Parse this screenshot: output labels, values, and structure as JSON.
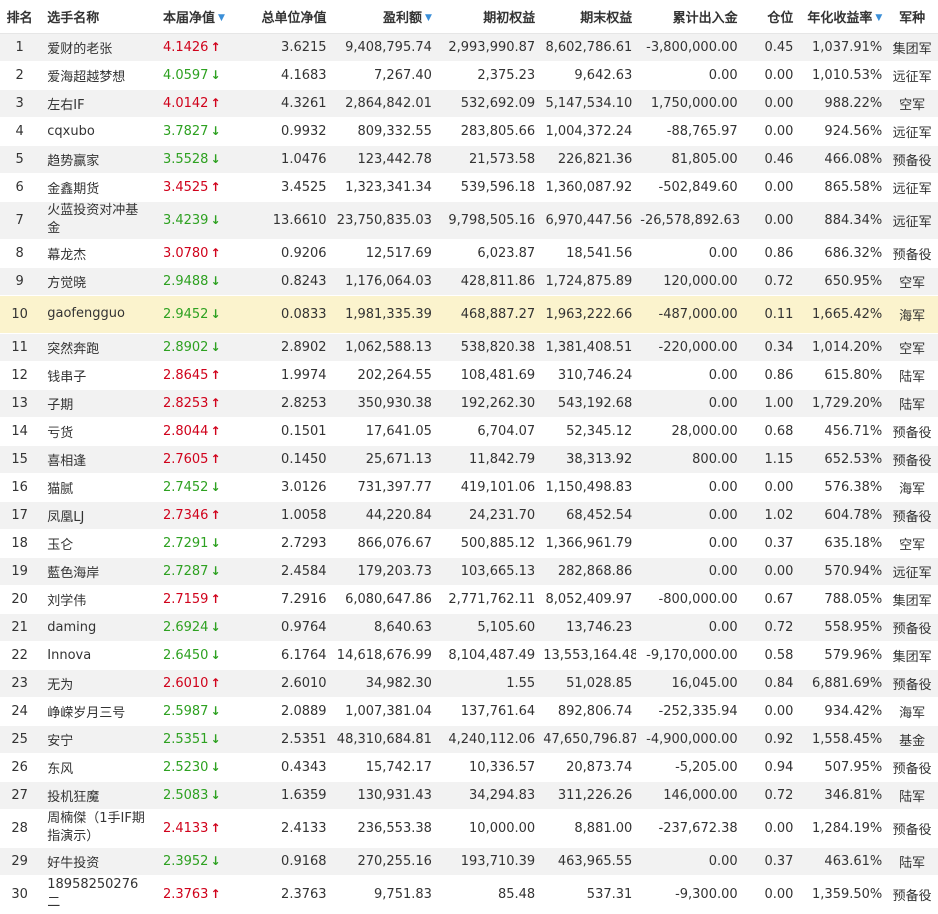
{
  "header": {
    "rank": "排名",
    "name": "选手名称",
    "nav": "本届净值",
    "unit_nav": "总单位净值",
    "profit": "盈利额",
    "init_equity": "期初权益",
    "end_equity": "期末权益",
    "net_flow": "累计出入金",
    "position": "仓位",
    "annual_return": "年化收益率",
    "army": "军种",
    "sort_indicator": "▼"
  },
  "colors": {
    "up": "#d0021b",
    "down": "#2ea121",
    "highlight": "#fbf3cd",
    "sort_icon": "#3b8fd8"
  },
  "icons": {
    "up": "arrow-up-icon",
    "down": "arrow-down-icon",
    "sort": "sort-down-icon"
  },
  "rows": [
    {
      "rank": "1",
      "name": "爱财的老张",
      "nav": "4.1426",
      "dir": "up",
      "unit_nav": "3.6215",
      "profit": "9,408,795.74",
      "init_equity": "2,993,990.87",
      "end_equity": "8,602,786.61",
      "net_flow": "-3,800,000.00",
      "position": "0.45",
      "annual_return": "1,037.91%",
      "army": "集团军"
    },
    {
      "rank": "2",
      "name": "爱海超越梦想",
      "nav": "4.0597",
      "dir": "down",
      "unit_nav": "4.1683",
      "profit": "7,267.40",
      "init_equity": "2,375.23",
      "end_equity": "9,642.63",
      "net_flow": "0.00",
      "position": "0.00",
      "annual_return": "1,010.53%",
      "army": "远征军"
    },
    {
      "rank": "3",
      "name": "左右IF",
      "nav": "4.0142",
      "dir": "up",
      "unit_nav": "4.3261",
      "profit": "2,864,842.01",
      "init_equity": "532,692.09",
      "end_equity": "5,147,534.10",
      "net_flow": "1,750,000.00",
      "position": "0.00",
      "annual_return": "988.22%",
      "army": "空军"
    },
    {
      "rank": "4",
      "name": "cqxubo",
      "nav": "3.7827",
      "dir": "down",
      "unit_nav": "0.9932",
      "profit": "809,332.55",
      "init_equity": "283,805.66",
      "end_equity": "1,004,372.24",
      "net_flow": "-88,765.97",
      "position": "0.00",
      "annual_return": "924.56%",
      "army": "远征军"
    },
    {
      "rank": "5",
      "name": "趋势赢家",
      "nav": "3.5528",
      "dir": "down",
      "unit_nav": "1.0476",
      "profit": "123,442.78",
      "init_equity": "21,573.58",
      "end_equity": "226,821.36",
      "net_flow": "81,805.00",
      "position": "0.46",
      "annual_return": "466.08%",
      "army": "预备役"
    },
    {
      "rank": "6",
      "name": "金鑫期货",
      "nav": "3.4525",
      "dir": "up",
      "unit_nav": "3.4525",
      "profit": "1,323,341.34",
      "init_equity": "539,596.18",
      "end_equity": "1,360,087.92",
      "net_flow": "-502,849.60",
      "position": "0.00",
      "annual_return": "865.58%",
      "army": "远征军"
    },
    {
      "rank": "7",
      "name": "火蓝投资对冲基金",
      "nav": "3.4239",
      "dir": "down",
      "unit_nav": "13.6610",
      "profit": "23,750,835.03",
      "init_equity": "9,798,505.16",
      "end_equity": "6,970,447.56",
      "net_flow": "-26,578,892.63",
      "position": "0.00",
      "annual_return": "884.34%",
      "army": "远征军"
    },
    {
      "rank": "8",
      "name": "幕龙杰",
      "nav": "3.0780",
      "dir": "up",
      "unit_nav": "0.9206",
      "profit": "12,517.69",
      "init_equity": "6,023.87",
      "end_equity": "18,541.56",
      "net_flow": "0.00",
      "position": "0.86",
      "annual_return": "686.32%",
      "army": "预备役"
    },
    {
      "rank": "9",
      "name": "方觉晓",
      "nav": "2.9488",
      "dir": "down",
      "unit_nav": "0.8243",
      "profit": "1,176,064.03",
      "init_equity": "428,811.86",
      "end_equity": "1,724,875.89",
      "net_flow": "120,000.00",
      "position": "0.72",
      "annual_return": "650.95%",
      "army": "空军"
    },
    {
      "rank": "10",
      "name": "gaofengguo",
      "nav": "2.9452",
      "dir": "down",
      "unit_nav": "0.0833",
      "profit": "1,981,335.39",
      "init_equity": "468,887.27",
      "end_equity": "1,963,222.66",
      "net_flow": "-487,000.00",
      "position": "0.11",
      "annual_return": "1,665.42%",
      "army": "海军",
      "highlight": true
    },
    {
      "rank": "11",
      "name": "突然奔跑",
      "nav": "2.8902",
      "dir": "down",
      "unit_nav": "2.8902",
      "profit": "1,062,588.13",
      "init_equity": "538,820.38",
      "end_equity": "1,381,408.51",
      "net_flow": "-220,000.00",
      "position": "0.34",
      "annual_return": "1,014.20%",
      "army": "空军"
    },
    {
      "rank": "12",
      "name": "钱串子",
      "nav": "2.8645",
      "dir": "up",
      "unit_nav": "1.9974",
      "profit": "202,264.55",
      "init_equity": "108,481.69",
      "end_equity": "310,746.24",
      "net_flow": "0.00",
      "position": "0.86",
      "annual_return": "615.80%",
      "army": "陆军"
    },
    {
      "rank": "13",
      "name": "子期",
      "nav": "2.8253",
      "dir": "up",
      "unit_nav": "2.8253",
      "profit": "350,930.38",
      "init_equity": "192,262.30",
      "end_equity": "543,192.68",
      "net_flow": "0.00",
      "position": "1.00",
      "annual_return": "1,729.20%",
      "army": "陆军"
    },
    {
      "rank": "14",
      "name": "亏货",
      "nav": "2.8044",
      "dir": "up",
      "unit_nav": "0.1501",
      "profit": "17,641.05",
      "init_equity": "6,704.07",
      "end_equity": "52,345.12",
      "net_flow": "28,000.00",
      "position": "0.68",
      "annual_return": "456.71%",
      "army": "预备役"
    },
    {
      "rank": "15",
      "name": "喜相逢",
      "nav": "2.7605",
      "dir": "up",
      "unit_nav": "0.1450",
      "profit": "25,671.13",
      "init_equity": "11,842.79",
      "end_equity": "38,313.92",
      "net_flow": "800.00",
      "position": "1.15",
      "annual_return": "652.53%",
      "army": "预备役"
    },
    {
      "rank": "16",
      "name": "猫腻",
      "nav": "2.7452",
      "dir": "down",
      "unit_nav": "3.0126",
      "profit": "731,397.77",
      "init_equity": "419,101.06",
      "end_equity": "1,150,498.83",
      "net_flow": "0.00",
      "position": "0.00",
      "annual_return": "576.38%",
      "army": "海军"
    },
    {
      "rank": "17",
      "name": "凤凰LJ",
      "nav": "2.7346",
      "dir": "up",
      "unit_nav": "1.0058",
      "profit": "44,220.84",
      "init_equity": "24,231.70",
      "end_equity": "68,452.54",
      "net_flow": "0.00",
      "position": "1.02",
      "annual_return": "604.78%",
      "army": "预备役"
    },
    {
      "rank": "18",
      "name": "玉仑",
      "nav": "2.7291",
      "dir": "down",
      "unit_nav": "2.7293",
      "profit": "866,076.67",
      "init_equity": "500,885.12",
      "end_equity": "1,366,961.79",
      "net_flow": "0.00",
      "position": "0.37",
      "annual_return": "635.18%",
      "army": "空军"
    },
    {
      "rank": "19",
      "name": "藍色海岸",
      "nav": "2.7287",
      "dir": "down",
      "unit_nav": "2.4584",
      "profit": "179,203.73",
      "init_equity": "103,665.13",
      "end_equity": "282,868.86",
      "net_flow": "0.00",
      "position": "0.00",
      "annual_return": "570.94%",
      "army": "远征军"
    },
    {
      "rank": "20",
      "name": "刘学伟",
      "nav": "2.7159",
      "dir": "up",
      "unit_nav": "7.2916",
      "profit": "6,080,647.86",
      "init_equity": "2,771,762.11",
      "end_equity": "8,052,409.97",
      "net_flow": "-800,000.00",
      "position": "0.67",
      "annual_return": "788.05%",
      "army": "集团军"
    },
    {
      "rank": "21",
      "name": "daming",
      "nav": "2.6924",
      "dir": "down",
      "unit_nav": "0.9764",
      "profit": "8,640.63",
      "init_equity": "5,105.60",
      "end_equity": "13,746.23",
      "net_flow": "0.00",
      "position": "0.72",
      "annual_return": "558.95%",
      "army": "预备役"
    },
    {
      "rank": "22",
      "name": "Innova",
      "nav": "2.6450",
      "dir": "down",
      "unit_nav": "6.1764",
      "profit": "14,618,676.99",
      "init_equity": "8,104,487.49",
      "end_equity": "13,553,164.48",
      "net_flow": "-9,170,000.00",
      "position": "0.58",
      "annual_return": "579.96%",
      "army": "集团军"
    },
    {
      "rank": "23",
      "name": "无为",
      "nav": "2.6010",
      "dir": "up",
      "unit_nav": "2.6010",
      "profit": "34,982.30",
      "init_equity": "1.55",
      "end_equity": "51,028.85",
      "net_flow": "16,045.00",
      "position": "0.84",
      "annual_return": "6,881.69%",
      "army": "预备役"
    },
    {
      "rank": "24",
      "name": "峥嵘岁月三号",
      "nav": "2.5987",
      "dir": "down",
      "unit_nav": "2.0889",
      "profit": "1,007,381.04",
      "init_equity": "137,761.64",
      "end_equity": "892,806.74",
      "net_flow": "-252,335.94",
      "position": "0.00",
      "annual_return": "934.42%",
      "army": "海军"
    },
    {
      "rank": "25",
      "name": "安宁",
      "nav": "2.5351",
      "dir": "down",
      "unit_nav": "2.5351",
      "profit": "48,310,684.81",
      "init_equity": "4,240,112.06",
      "end_equity": "47,650,796.87",
      "net_flow": "-4,900,000.00",
      "position": "0.92",
      "annual_return": "1,558.45%",
      "army": "基金"
    },
    {
      "rank": "26",
      "name": "东风",
      "nav": "2.5230",
      "dir": "down",
      "unit_nav": "0.4343",
      "profit": "15,742.17",
      "init_equity": "10,336.57",
      "end_equity": "20,873.74",
      "net_flow": "-5,205.00",
      "position": "0.94",
      "annual_return": "507.95%",
      "army": "预备役"
    },
    {
      "rank": "27",
      "name": "投机狂魔",
      "nav": "2.5083",
      "dir": "down",
      "unit_nav": "1.6359",
      "profit": "130,931.43",
      "init_equity": "34,294.83",
      "end_equity": "311,226.26",
      "net_flow": "146,000.00",
      "position": "0.72",
      "annual_return": "346.81%",
      "army": "陆军"
    },
    {
      "rank": "28",
      "name": "周楠傑（1手IF期指演示）",
      "nav": "2.4133",
      "dir": "up",
      "unit_nav": "2.4133",
      "profit": "236,553.38",
      "init_equity": "10,000.00",
      "end_equity": "8,881.00",
      "net_flow": "-237,672.38",
      "position": "0.00",
      "annual_return": "1,284.19%",
      "army": "预备役"
    },
    {
      "rank": "29",
      "name": "好牛投资",
      "nav": "2.3952",
      "dir": "down",
      "unit_nav": "0.9168",
      "profit": "270,255.16",
      "init_equity": "193,710.39",
      "end_equity": "463,965.55",
      "net_flow": "0.00",
      "position": "0.37",
      "annual_return": "463.61%",
      "army": "陆军"
    },
    {
      "rank": "30",
      "name": "18958250276二",
      "nav": "2.3763",
      "dir": "up",
      "unit_nav": "2.3763",
      "profit": "9,751.83",
      "init_equity": "85.48",
      "end_equity": "537.31",
      "net_flow": "-9,300.00",
      "position": "0.00",
      "annual_return": "1,359.50%",
      "army": "预备役"
    }
  ]
}
